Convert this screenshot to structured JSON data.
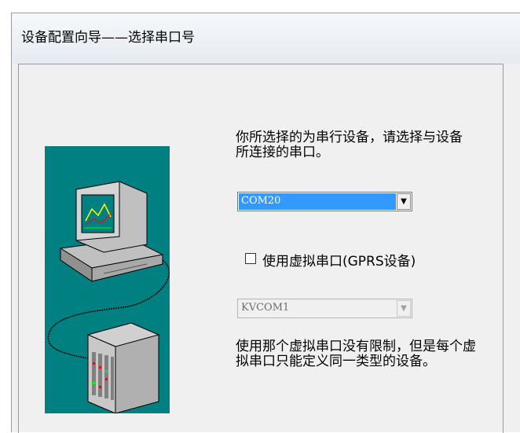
{
  "window": {
    "title": "设备配置向导——选择串口号"
  },
  "main": {
    "description": "你所选择的为串行设备，请选择与设备所连接的串口。",
    "serial_port": {
      "value": "COM20"
    },
    "virtual_port_checkbox": {
      "label": "使用虚拟串口(GPRS设备)",
      "checked": false
    },
    "virtual_port_select": {
      "value": "KVCOM1",
      "enabled": false
    },
    "note": "使用那个虚拟串口没有限制，但是每个虚拟串口只能定义同一类型的设备。"
  },
  "colors": {
    "panel": "#008080",
    "selection": "#3399ff"
  },
  "icons": [
    "dropdown-arrow-icon",
    "computer-icon",
    "plc-device-icon"
  ]
}
